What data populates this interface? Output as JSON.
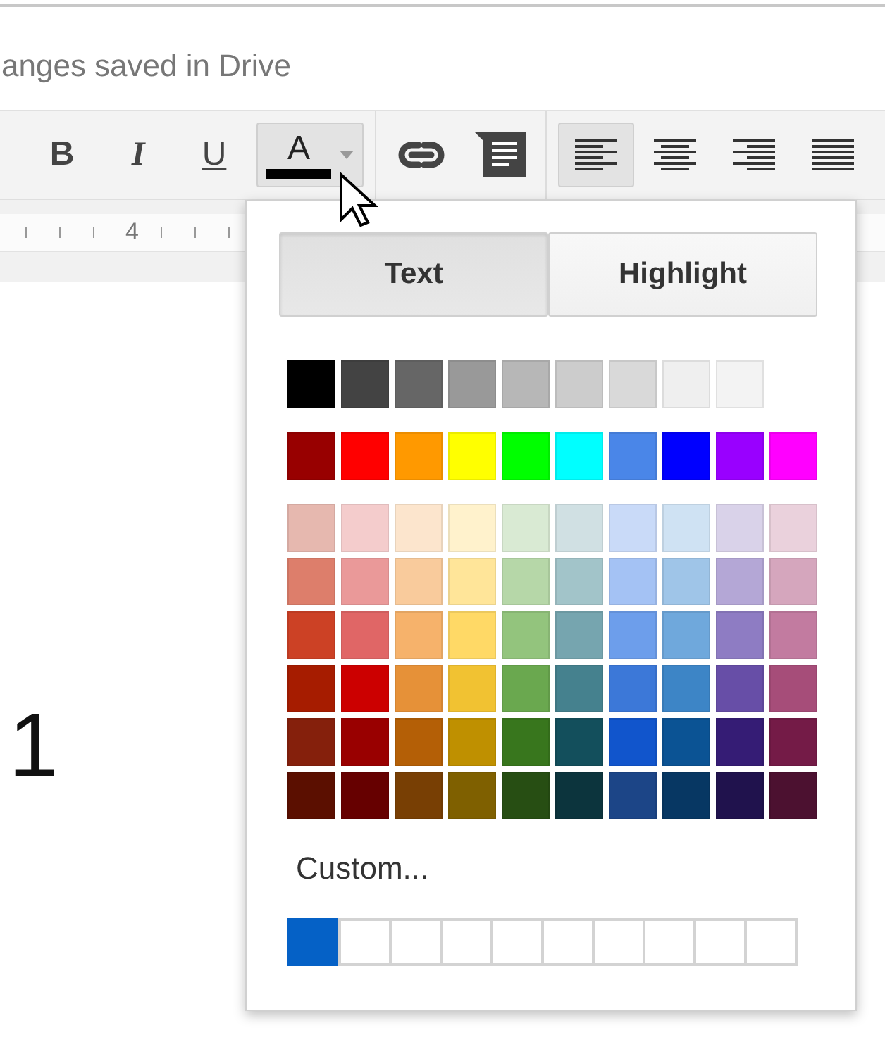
{
  "status": "anges saved in Drive",
  "toolbar": {
    "format_buttons": [
      {
        "kind": "bold",
        "label": "B",
        "selected": false
      },
      {
        "kind": "italic",
        "label": "I",
        "selected": false
      },
      {
        "kind": "underline",
        "label": "U",
        "selected": false
      },
      {
        "kind": "text-color",
        "label": "A",
        "selected": true,
        "color": "#000000"
      }
    ],
    "insert_buttons": [
      {
        "kind": "link",
        "selected": false
      },
      {
        "kind": "comment",
        "selected": false
      }
    ],
    "align_buttons": [
      {
        "kind": "left",
        "selected": true
      },
      {
        "kind": "center",
        "selected": false
      },
      {
        "kind": "right",
        "selected": false
      },
      {
        "kind": "justify",
        "selected": false
      }
    ]
  },
  "ruler": {
    "label": "4"
  },
  "document": {
    "text": "1"
  },
  "color_menu": {
    "tabs": [
      {
        "label": "Text",
        "selected": true
      },
      {
        "label": "Highlight",
        "selected": false
      }
    ],
    "palette_rows": [
      {
        "kind": "grays",
        "swatches": [
          {
            "color": "#000000"
          },
          {
            "color": "#434343"
          },
          {
            "color": "#666666"
          },
          {
            "color": "#999999"
          },
          {
            "color": "#b7b7b7"
          },
          {
            "color": "#cccccc"
          },
          {
            "color": "#d9d9d9"
          },
          {
            "color": "#efefef"
          },
          {
            "color": "#f3f3f3"
          }
        ]
      },
      {
        "kind": "bright",
        "swatches": [
          {
            "color": "#980000"
          },
          {
            "color": "#ff0000"
          },
          {
            "color": "#ff9900"
          },
          {
            "color": "#ffff00"
          },
          {
            "color": "#00ff00"
          },
          {
            "color": "#00ffff"
          },
          {
            "color": "#4a86e8"
          },
          {
            "color": "#0000ff"
          },
          {
            "color": "#9900ff"
          },
          {
            "color": "#ff00ff"
          }
        ]
      },
      {
        "kind": "shades",
        "swatches": [
          {
            "color": "#e6b8af"
          },
          {
            "color": "#f4cccc"
          },
          {
            "color": "#fce5cd"
          },
          {
            "color": "#fff2cc"
          },
          {
            "color": "#d9ead3"
          },
          {
            "color": "#d0e0e3"
          },
          {
            "color": "#c9daf8"
          },
          {
            "color": "#cfe2f3"
          },
          {
            "color": "#d9d2e9"
          },
          {
            "color": "#ead1dc"
          }
        ]
      },
      {
        "kind": "shades",
        "swatches": [
          {
            "color": "#dd7e6b"
          },
          {
            "color": "#ea9999"
          },
          {
            "color": "#f9cb9c"
          },
          {
            "color": "#ffe599"
          },
          {
            "color": "#b6d7a8"
          },
          {
            "color": "#a2c4c9"
          },
          {
            "color": "#a4c2f4"
          },
          {
            "color": "#9fc5e8"
          },
          {
            "color": "#b4a7d6"
          },
          {
            "color": "#d5a6bd"
          }
        ]
      },
      {
        "kind": "shades",
        "swatches": [
          {
            "color": "#cc4125"
          },
          {
            "color": "#e06666"
          },
          {
            "color": "#f6b26b"
          },
          {
            "color": "#ffd966"
          },
          {
            "color": "#93c47d"
          },
          {
            "color": "#76a5af"
          },
          {
            "color": "#6d9eeb"
          },
          {
            "color": "#6fa8dc"
          },
          {
            "color": "#8e7cc3"
          },
          {
            "color": "#c27ba0"
          }
        ]
      },
      {
        "kind": "shades",
        "swatches": [
          {
            "color": "#a61c00"
          },
          {
            "color": "#cc0000"
          },
          {
            "color": "#e69138"
          },
          {
            "color": "#f1c232"
          },
          {
            "color": "#6aa84f"
          },
          {
            "color": "#45818e"
          },
          {
            "color": "#3c78d8"
          },
          {
            "color": "#3d85c6"
          },
          {
            "color": "#674ea7"
          },
          {
            "color": "#a64d79"
          }
        ]
      },
      {
        "kind": "shades",
        "swatches": [
          {
            "color": "#85200c"
          },
          {
            "color": "#990000"
          },
          {
            "color": "#b45f06"
          },
          {
            "color": "#bf9000"
          },
          {
            "color": "#38761d"
          },
          {
            "color": "#134f5c"
          },
          {
            "color": "#1155cc"
          },
          {
            "color": "#0b5394"
          },
          {
            "color": "#351c75"
          },
          {
            "color": "#741b47"
          }
        ]
      },
      {
        "kind": "shades",
        "swatches": [
          {
            "color": "#5b0f00"
          },
          {
            "color": "#660000"
          },
          {
            "color": "#783f04"
          },
          {
            "color": "#7f6000"
          },
          {
            "color": "#274e13"
          },
          {
            "color": "#0c343d"
          },
          {
            "color": "#1c4587"
          },
          {
            "color": "#073763"
          },
          {
            "color": "#20124d"
          },
          {
            "color": "#4c1130"
          }
        ]
      }
    ],
    "custom_label": "Custom...",
    "custom_colors": [
      {
        "filled": true,
        "color": "#0561c6"
      },
      {
        "filled": false
      },
      {
        "filled": false
      },
      {
        "filled": false
      },
      {
        "filled": false
      },
      {
        "filled": false
      },
      {
        "filled": false
      },
      {
        "filled": false
      },
      {
        "filled": false
      },
      {
        "filled": false
      }
    ]
  }
}
